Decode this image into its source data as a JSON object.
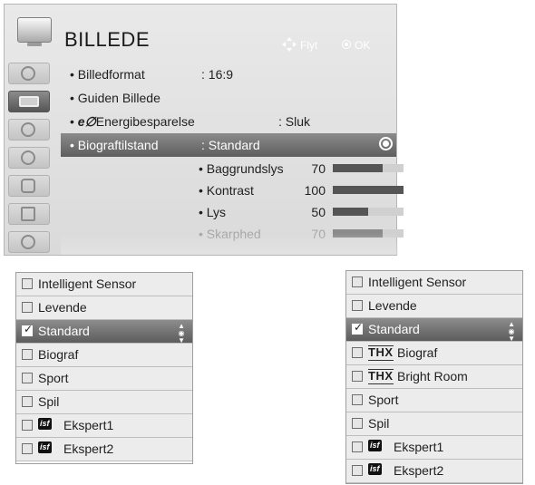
{
  "main_menu": {
    "title": "BILLEDE",
    "hint_move": "Flyt",
    "hint_ok": "OK",
    "sidebar_icons": [
      "disc-icon",
      "monitor-icon",
      "speaker-icon",
      "clock-icon",
      "lock-icon",
      "box-icon",
      "globe-icon"
    ],
    "rows": [
      {
        "label": "• Billedformat",
        "value": ": 16:9"
      },
      {
        "label": "• Guiden Billede",
        "value": ""
      },
      {
        "prefix": "• ",
        "eco": "e∅",
        "label": "Energibesparelse",
        "value": ": Sluk"
      },
      {
        "label": "• Biograftilstand",
        "value": ": Standard",
        "selected": true
      }
    ],
    "adjustments": [
      {
        "label": "• Baggrundslys",
        "value": "70",
        "level": 0.7
      },
      {
        "label": "• Kontrast",
        "value": "100",
        "level": 1.0
      },
      {
        "label": "• Lys",
        "value": "50",
        "level": 0.5
      },
      {
        "label": "• Skarphed",
        "value": "70",
        "level": 0.7,
        "dim": true
      }
    ]
  },
  "list_left": {
    "options": [
      {
        "label": "Intelligent Sensor",
        "checked": false
      },
      {
        "label": "Levende",
        "checked": false
      },
      {
        "label": "Standard",
        "checked": true,
        "selected": true
      },
      {
        "label": "Biograf",
        "checked": false
      },
      {
        "label": "Sport",
        "checked": false
      },
      {
        "label": "Spil",
        "checked": false
      },
      {
        "label": "Ekspert1",
        "logo": "isf"
      },
      {
        "label": "Ekspert2",
        "logo": "isf"
      }
    ]
  },
  "list_right": {
    "options": [
      {
        "label": "Intelligent Sensor"
      },
      {
        "label": "Levende"
      },
      {
        "label": "Standard",
        "checked": true,
        "selected": true
      },
      {
        "label": "Biograf",
        "logo": "THX"
      },
      {
        "label": "Bright Room",
        "logo": "THX"
      },
      {
        "label": "Sport"
      },
      {
        "label": "Spil"
      },
      {
        "label": "Ekspert1",
        "logo": "isf"
      },
      {
        "label": "Ekspert2",
        "logo": "isf"
      }
    ]
  },
  "check_glyph": "✓",
  "updown_glyph": "▲◉▼"
}
